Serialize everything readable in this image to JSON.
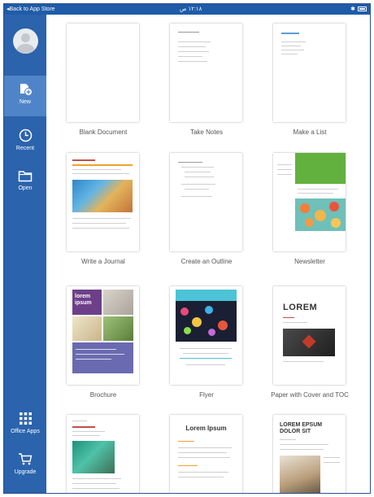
{
  "status_bar": {
    "back_label": "Back to App Store",
    "time": "١٢:١٨ ص"
  },
  "sidebar": {
    "items": [
      {
        "label": "New",
        "icon": "new-document-icon"
      },
      {
        "label": "Recent",
        "icon": "clock-icon"
      },
      {
        "label": "Open",
        "icon": "folder-icon"
      },
      {
        "label": "Office Apps",
        "icon": "app-grid-icon"
      },
      {
        "label": "Upgrade",
        "icon": "cart-icon"
      }
    ]
  },
  "templates": [
    {
      "label": "Blank Document"
    },
    {
      "label": "Take Notes"
    },
    {
      "label": "Make a List"
    },
    {
      "label": "Write a Journal"
    },
    {
      "label": "Create an Outline"
    },
    {
      "label": "Newsletter"
    },
    {
      "label": "Brochure",
      "thumb_text": "lorem ipsum"
    },
    {
      "label": "Flyer"
    },
    {
      "label": "Paper with Cover and TOC",
      "thumb_text": "LOREM"
    },
    {
      "label": ""
    },
    {
      "label": "",
      "thumb_text": "Lorem Ipsum"
    },
    {
      "label": "",
      "thumb_text": "LOREM EPSUM DOLOR SIT"
    }
  ],
  "colors": {
    "sidebar": "#2b63ad",
    "sidebar_active": "#4f85c8",
    "status_bar": "#1f5ca8"
  }
}
